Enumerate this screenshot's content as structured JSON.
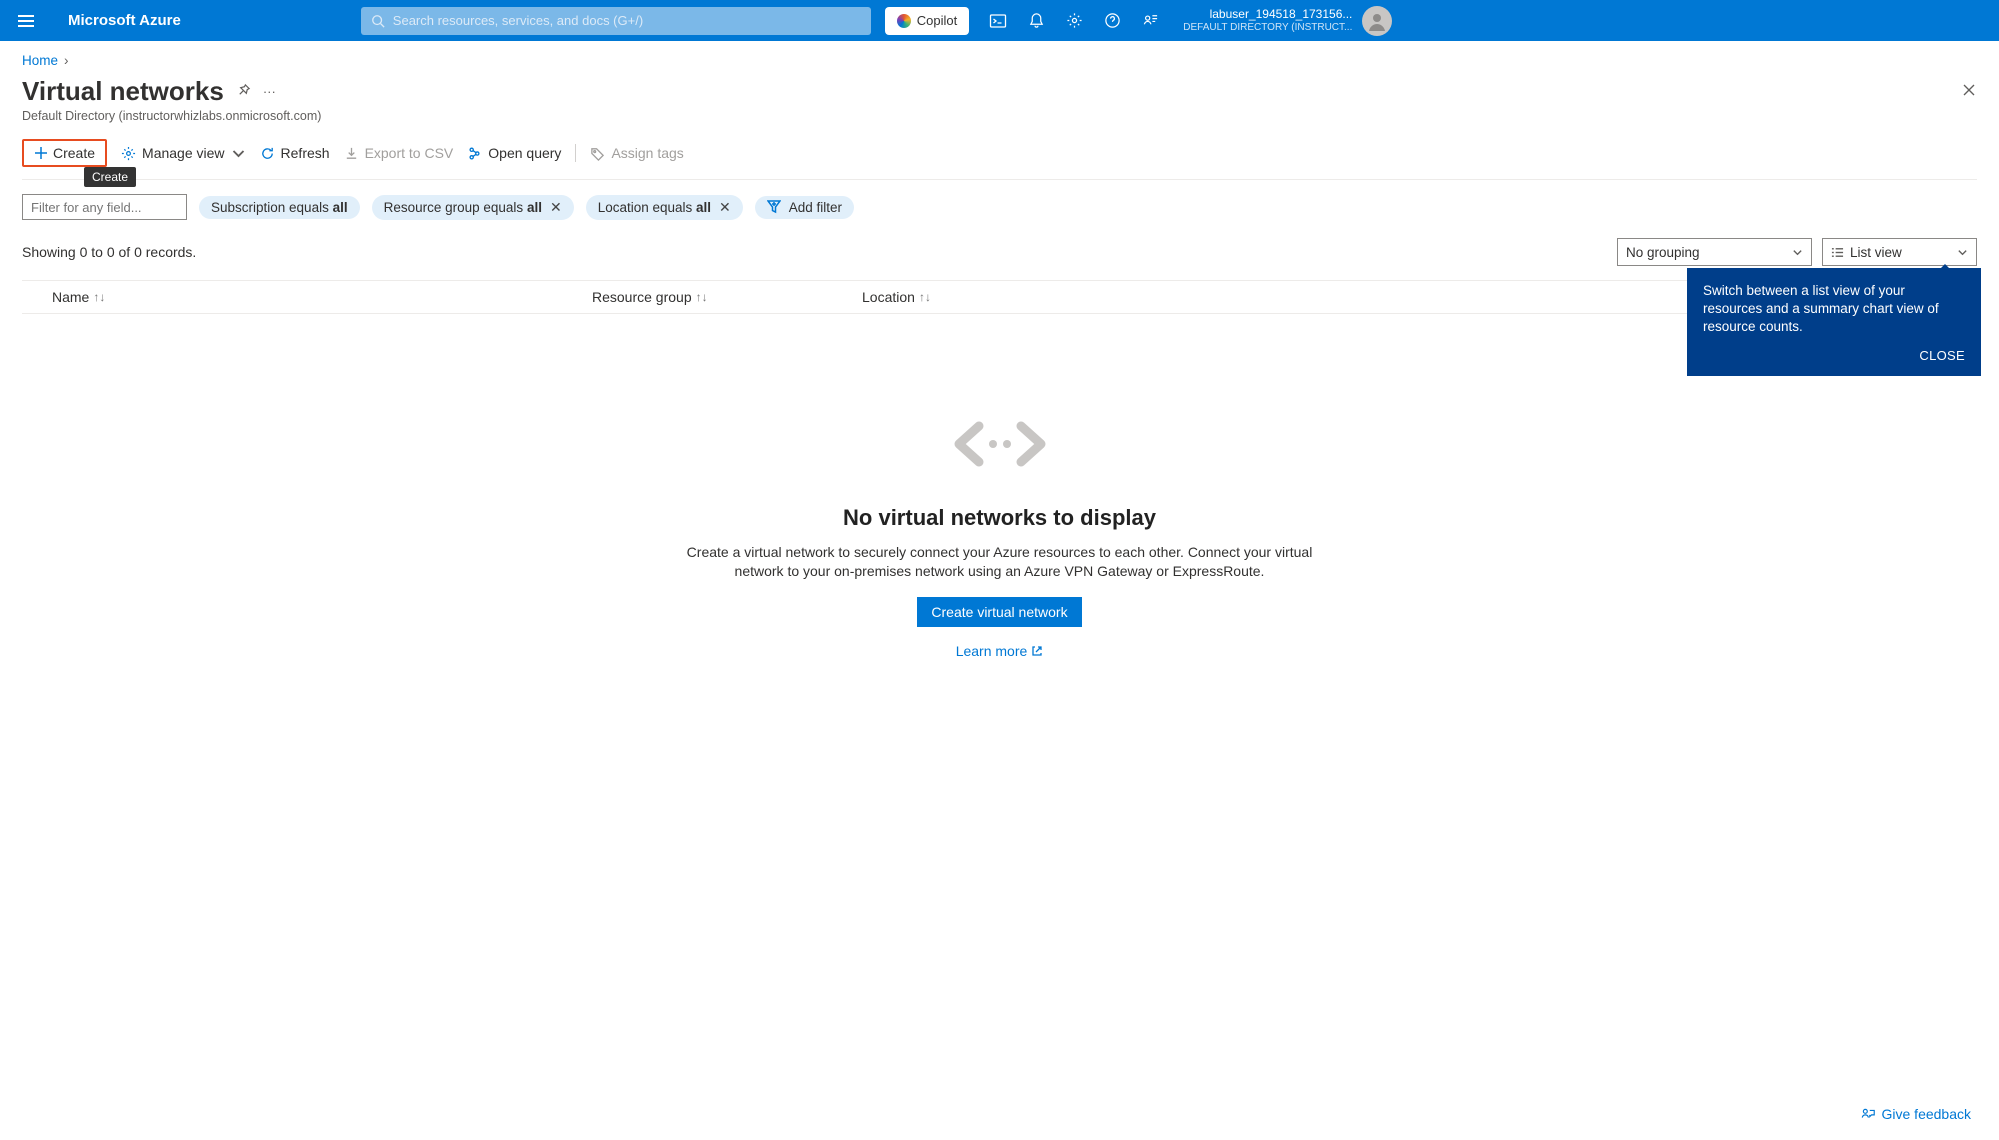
{
  "topbar": {
    "brand": "Microsoft Azure",
    "search_placeholder": "Search resources, services, and docs (G+/)",
    "copilot_label": "Copilot",
    "user_name": "labuser_194518_173156...",
    "user_directory": "DEFAULT DIRECTORY (INSTRUCT..."
  },
  "breadcrumb": {
    "home": "Home"
  },
  "page": {
    "title": "Virtual networks",
    "subtitle": "Default Directory (instructorwhizlabs.onmicrosoft.com)"
  },
  "commands": {
    "create": "Create",
    "create_tooltip": "Create",
    "manage_view": "Manage view",
    "refresh": "Refresh",
    "export_csv": "Export to CSV",
    "open_query": "Open query",
    "assign_tags": "Assign tags"
  },
  "filters": {
    "input_placeholder": "Filter for any field...",
    "subscription_prefix": "Subscription equals ",
    "subscription_value": "all",
    "resource_group_prefix": "Resource group equals ",
    "resource_group_value": "all",
    "location_prefix": "Location equals ",
    "location_value": "all",
    "add_filter": "Add filter"
  },
  "records_text": "Showing 0 to 0 of 0 records.",
  "selects": {
    "grouping": "No grouping",
    "view": "List view"
  },
  "columns": {
    "name": "Name",
    "resource_group": "Resource group",
    "location": "Location"
  },
  "callout": {
    "text": "Switch between a list view of your resources and a summary chart view of resource counts.",
    "close": "CLOSE"
  },
  "empty": {
    "title": "No virtual networks to display",
    "desc": "Create a virtual network to securely connect your Azure resources to each other. Connect your virtual network to your on-premises network using an Azure VPN Gateway or ExpressRoute.",
    "button": "Create virtual network",
    "learn_more": "Learn more"
  },
  "feedback": "Give feedback"
}
